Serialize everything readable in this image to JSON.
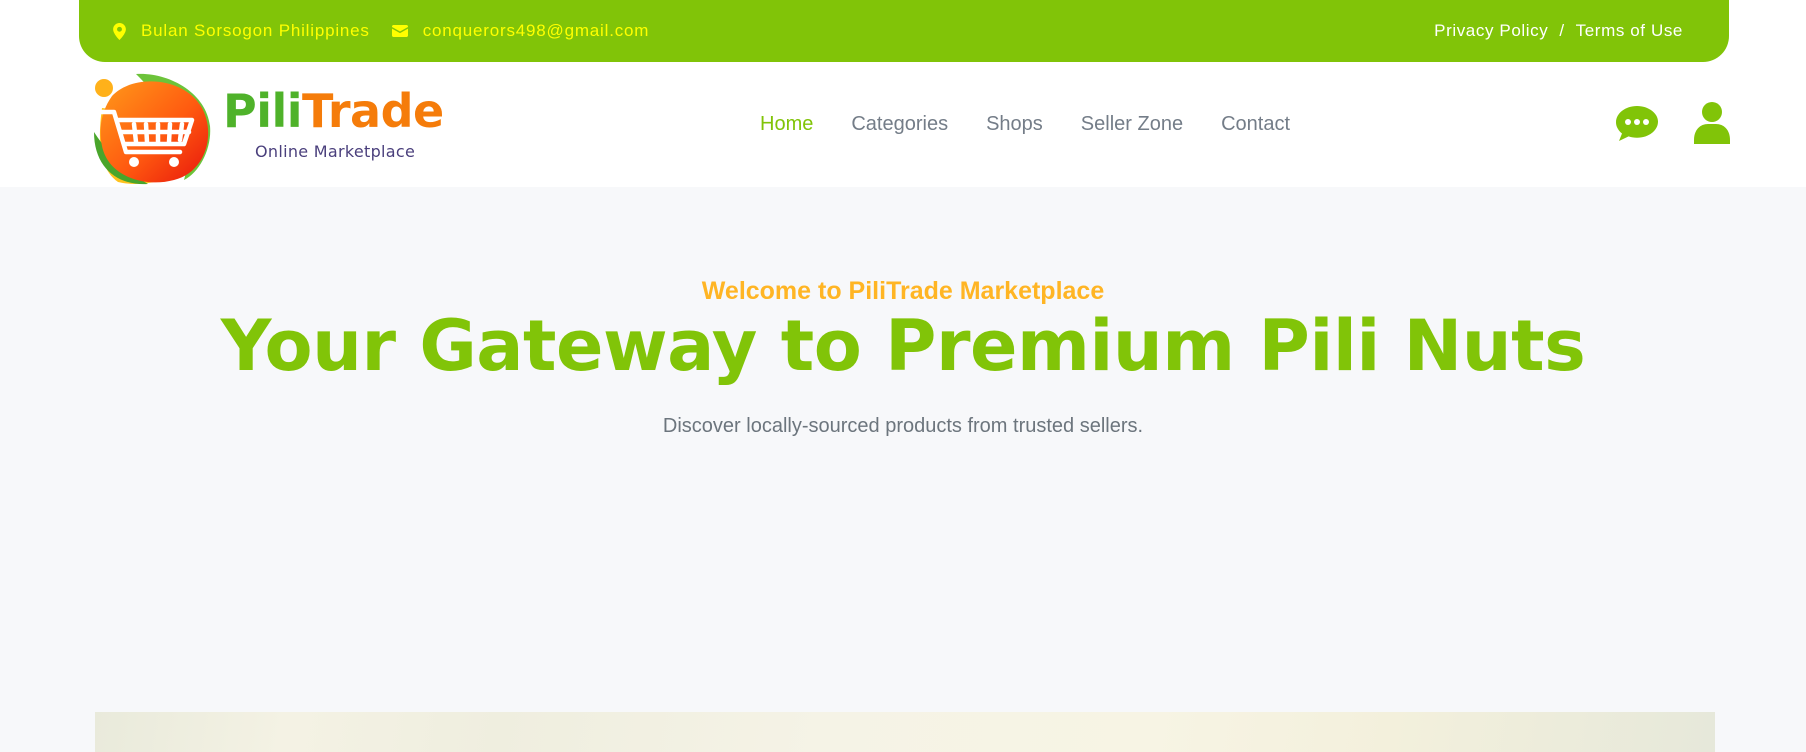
{
  "topbar": {
    "location": "Bulan Sorsogon Philippines",
    "email": "conquerors498@gmail.com",
    "privacy_policy": "Privacy Policy",
    "separator": "/",
    "terms": "Terms of Use",
    "icons": [
      "map-marker-icon",
      "envelope-icon"
    ]
  },
  "brand": {
    "name_part1": "Pili",
    "name_part2": "Trade",
    "tagline": "Online Marketplace"
  },
  "nav": {
    "items": [
      {
        "label": "Home",
        "active": true
      },
      {
        "label": "Categories",
        "active": false
      },
      {
        "label": "Shops",
        "active": false
      },
      {
        "label": "Seller Zone",
        "active": false
      },
      {
        "label": "Contact",
        "active": false
      }
    ],
    "icons": [
      "chat-icon",
      "user-icon"
    ]
  },
  "hero": {
    "eyebrow": "Welcome to PiliTrade Marketplace",
    "title": "Your Gateway to Premium Pili Nuts",
    "subtitle": "Discover locally-sourced products from trusted sellers."
  },
  "colors": {
    "primary": "#81c408",
    "accent_yellow": "#ffff00",
    "eyebrow": "#ffb524",
    "nav_text": "#747d88",
    "hero_bg": "#f7f8fa"
  }
}
